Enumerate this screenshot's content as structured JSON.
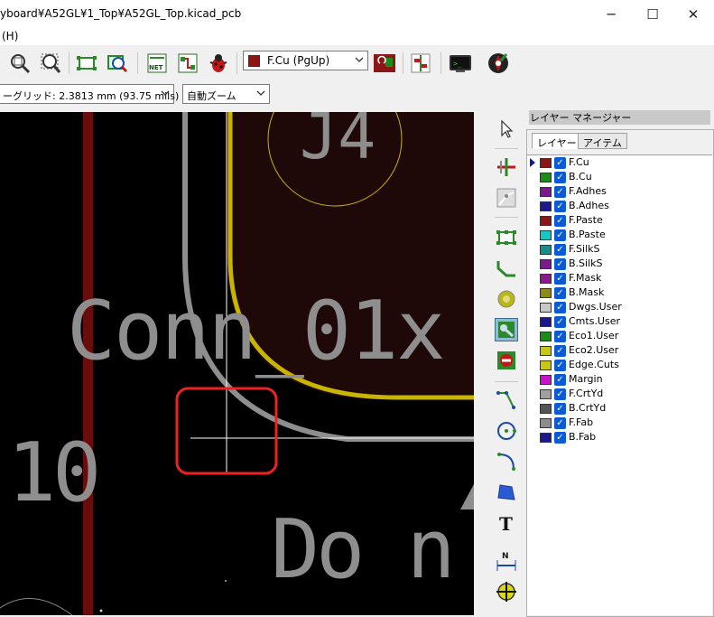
{
  "window": {
    "title": "yboard¥A52GL¥1_Top¥A52GL_Top.kicad_pcb",
    "minimize": "─",
    "maximize": "☐",
    "close": "✕"
  },
  "menu": {
    "help": "(H)"
  },
  "toolbar": {
    "layer_select_value": "F.Cu (PgUp)",
    "layer_select_color": "#8c1616",
    "icons": [
      "zoom-fit-icon",
      "zoom-selection-icon",
      "footprint-library-icon",
      "footprint-inspect-icon",
      "netlist-icon",
      "update-pcb-icon",
      "drc-bug-icon",
      "layer-pair-icon",
      "scripting-console-icon",
      "plot-icon",
      "python-console-icon",
      "compass-icon"
    ]
  },
  "toolbar2": {
    "grid_value": "ーグリッド: 2.3813 mm (93.75 mils)",
    "zoom_value": "自動ズーム"
  },
  "canvas": {
    "ref_text": "J4",
    "value_text": "Conn_01x",
    "pin_text": "10",
    "lower_text": "Do n",
    "colors": {
      "background": "#000000",
      "copper_zone": "#1e0808",
      "edge_cuts": "#c9b400",
      "silk": "#8e8e8e",
      "trace": "#6a0c0c",
      "highlight": "#ee2222"
    }
  },
  "right_toolbar": {
    "icons": [
      "select-arrow-icon",
      "highlight-net-icon",
      "local-ratsnest-icon",
      "add-footprint-icon",
      "route-track-icon",
      "add-via-icon",
      "add-zone-icon",
      "keepout-icon",
      "draw-line-icon",
      "draw-circle-icon",
      "draw-arc-icon",
      "draw-polygon-icon",
      "add-text-icon",
      "add-dimension-icon",
      "place-origin-icon"
    ]
  },
  "layer_manager": {
    "title": "レイヤー マネージャー",
    "tabs": [
      "レイヤー",
      "アイテム"
    ],
    "layers": [
      {
        "name": "F.Cu",
        "color": "#8c1616",
        "current": true
      },
      {
        "name": "B.Cu",
        "color": "#1a8c1a"
      },
      {
        "name": "F.Adhes",
        "color": "#7a1a8c"
      },
      {
        "name": "B.Adhes",
        "color": "#1a1a8c"
      },
      {
        "name": "F.Paste",
        "color": "#8c1616"
      },
      {
        "name": "B.Paste",
        "color": "#14c8c8"
      },
      {
        "name": "F.SilkS",
        "color": "#1a8c8c"
      },
      {
        "name": "B.SilkS",
        "color": "#7a1a8c"
      },
      {
        "name": "F.Mask",
        "color": "#8c1a8c"
      },
      {
        "name": "B.Mask",
        "color": "#8c8c1a"
      },
      {
        "name": "Dwgs.User",
        "color": "#c8c8c8"
      },
      {
        "name": "Cmts.User",
        "color": "#1a1a8c"
      },
      {
        "name": "Eco1.User",
        "color": "#1a8c1a"
      },
      {
        "name": "Eco2.User",
        "color": "#c8c814"
      },
      {
        "name": "Edge.Cuts",
        "color": "#c8c814"
      },
      {
        "name": "Margin",
        "color": "#c814c8"
      },
      {
        "name": "F.CrtYd",
        "color": "#a0a0a0"
      },
      {
        "name": "B.CrtYd",
        "color": "#555555"
      },
      {
        "name": "F.Fab",
        "color": "#8c8c8c"
      },
      {
        "name": "B.Fab",
        "color": "#1a1a8c"
      }
    ]
  }
}
